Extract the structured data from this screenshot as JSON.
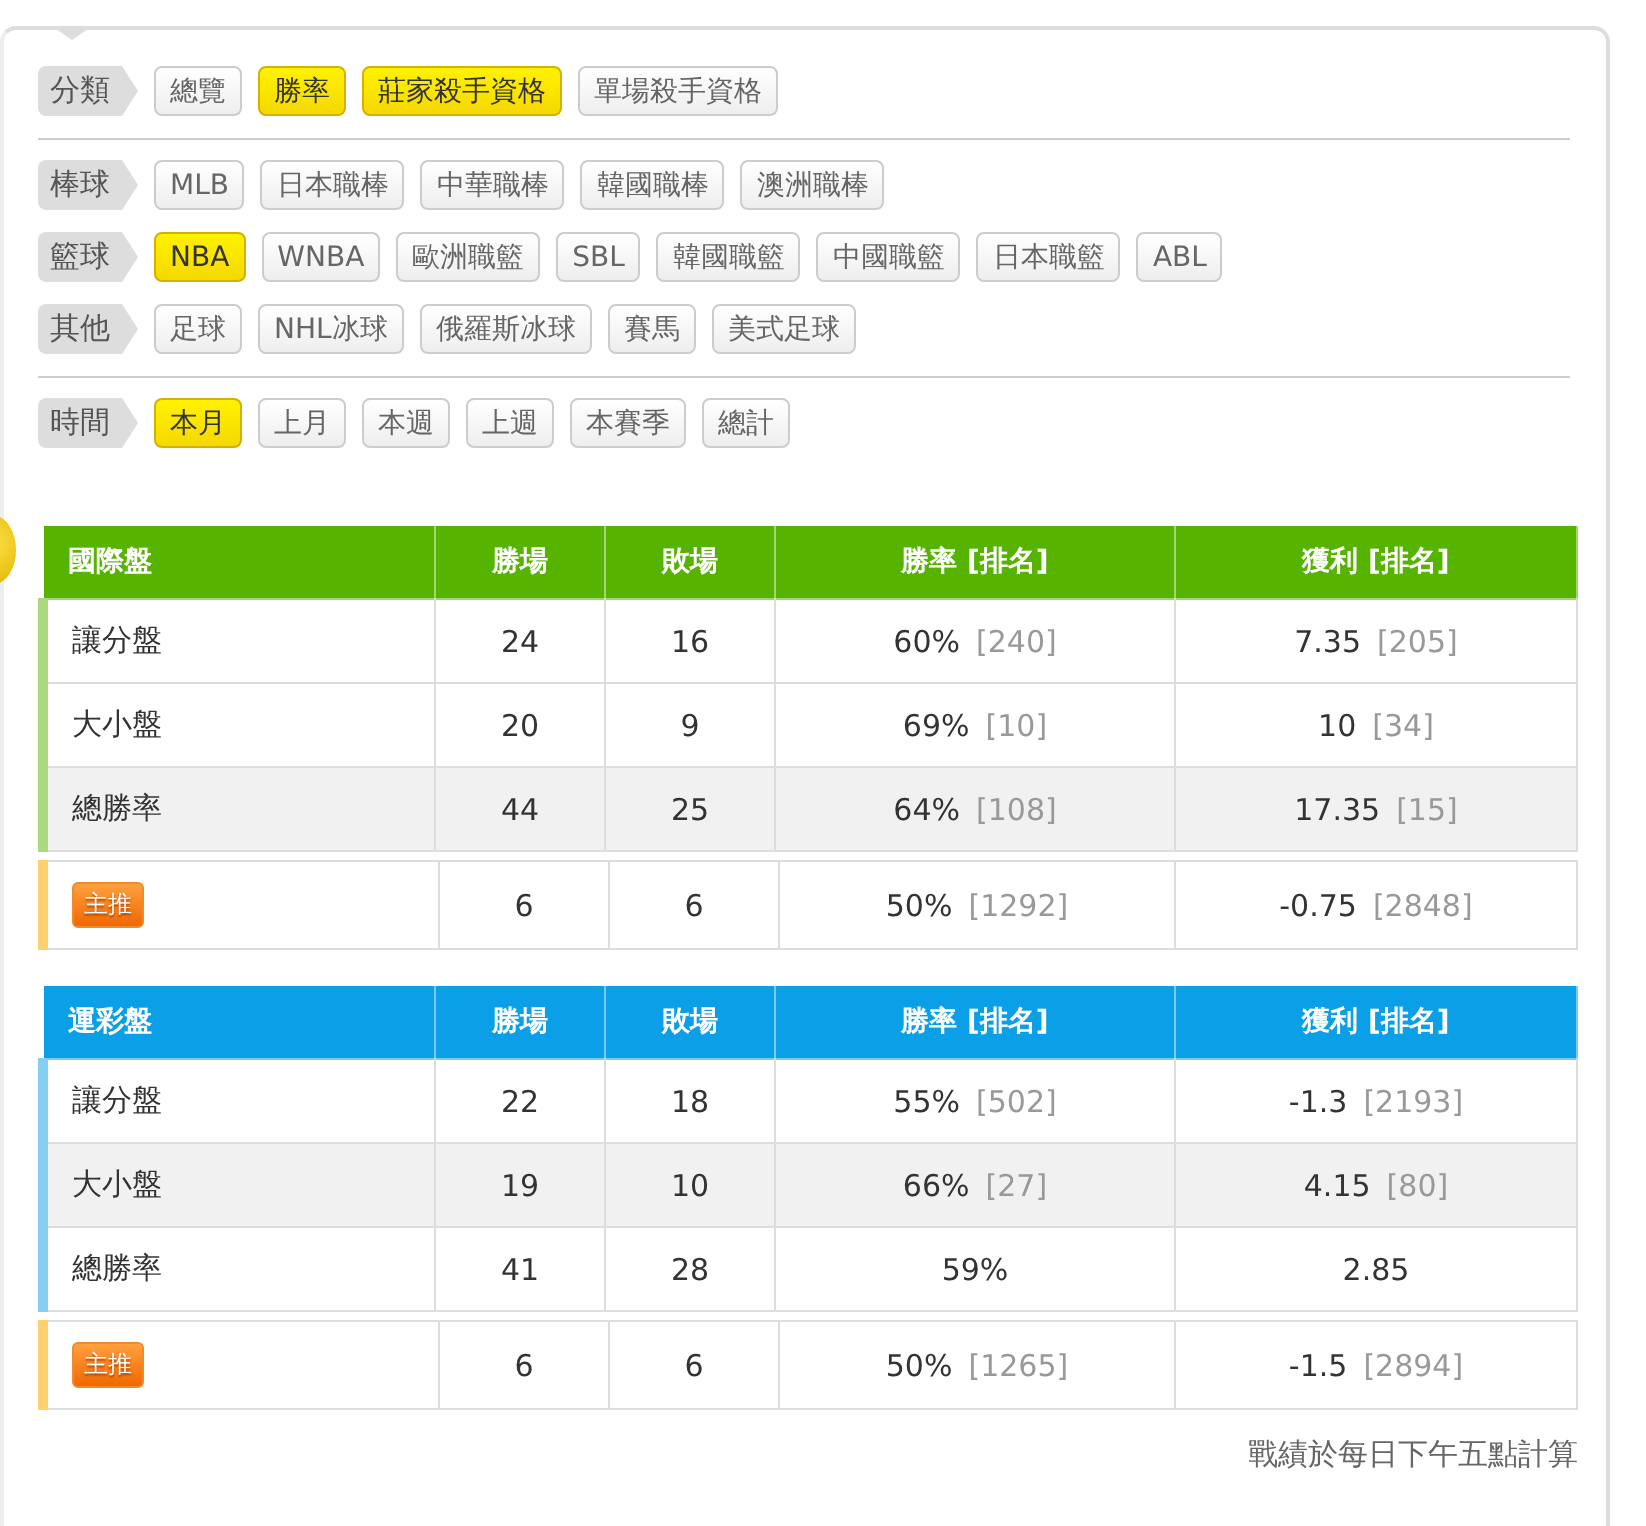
{
  "filter_sections": [
    [
      {
        "label": "分類",
        "options": [
          {
            "text": "總覽",
            "selected": false
          },
          {
            "text": "勝率",
            "selected": true
          },
          {
            "text": "莊家殺手資格",
            "selected": true
          },
          {
            "text": "單場殺手資格",
            "selected": false
          }
        ]
      }
    ],
    [
      {
        "label": "棒球",
        "options": [
          {
            "text": "MLB",
            "selected": false
          },
          {
            "text": "日本職棒",
            "selected": false
          },
          {
            "text": "中華職棒",
            "selected": false
          },
          {
            "text": "韓國職棒",
            "selected": false
          },
          {
            "text": "澳洲職棒",
            "selected": false
          }
        ]
      },
      {
        "label": "籃球",
        "options": [
          {
            "text": "NBA",
            "selected": true
          },
          {
            "text": "WNBA",
            "selected": false
          },
          {
            "text": "歐洲職籃",
            "selected": false
          },
          {
            "text": "SBL",
            "selected": false
          },
          {
            "text": "韓國職籃",
            "selected": false
          },
          {
            "text": "中國職籃",
            "selected": false
          },
          {
            "text": "日本職籃",
            "selected": false
          },
          {
            "text": "ABL",
            "selected": false
          }
        ]
      },
      {
        "label": "其他",
        "options": [
          {
            "text": "足球",
            "selected": false
          },
          {
            "text": "NHL冰球",
            "selected": false
          },
          {
            "text": "俄羅斯冰球",
            "selected": false
          },
          {
            "text": "賽馬",
            "selected": false
          },
          {
            "text": "美式足球",
            "selected": false
          }
        ]
      }
    ],
    [
      {
        "label": "時間",
        "options": [
          {
            "text": "本月",
            "selected": true
          },
          {
            "text": "上月",
            "selected": false
          },
          {
            "text": "本週",
            "selected": false
          },
          {
            "text": "上週",
            "selected": false
          },
          {
            "text": "本賽季",
            "selected": false
          },
          {
            "text": "總計",
            "selected": false
          }
        ]
      }
    ]
  ],
  "tables": [
    {
      "color": "#56b300",
      "columns": [
        "國際盤",
        "勝場",
        "敗場",
        "勝率 [排名]",
        "獲利 [排名]"
      ],
      "rows": [
        {
          "name": "讓分盤",
          "wins": "24",
          "losses": "16",
          "rate": "60%",
          "rate_rank": "[240]",
          "profit": "7.35",
          "profit_rank": "[205]",
          "shaded": false
        },
        {
          "name": "大小盤",
          "wins": "20",
          "losses": "9",
          "rate": "69%",
          "rate_rank": "[10]",
          "profit": "10",
          "profit_rank": "[34]",
          "shaded": false
        },
        {
          "name": "總勝率",
          "wins": "44",
          "losses": "25",
          "rate": "64%",
          "rate_rank": "[108]",
          "profit": "17.35",
          "profit_rank": "[15]",
          "shaded": true
        }
      ],
      "featured": {
        "badge": "主推",
        "wins": "6",
        "losses": "6",
        "rate": "50%",
        "rate_rank": "[1292]",
        "profit": "-0.75",
        "profit_rank": "[2848]"
      }
    },
    {
      "color": "#0a9fe6",
      "columns": [
        "運彩盤",
        "勝場",
        "敗場",
        "勝率 [排名]",
        "獲利 [排名]"
      ],
      "rows": [
        {
          "name": "讓分盤",
          "wins": "22",
          "losses": "18",
          "rate": "55%",
          "rate_rank": "[502]",
          "profit": "-1.3",
          "profit_rank": "[2193]",
          "shaded": false
        },
        {
          "name": "大小盤",
          "wins": "19",
          "losses": "10",
          "rate": "66%",
          "rate_rank": "[27]",
          "profit": "4.15",
          "profit_rank": "[80]",
          "shaded": true
        },
        {
          "name": "總勝率",
          "wins": "41",
          "losses": "28",
          "rate": "59%",
          "profit": "2.85",
          "shaded": false
        }
      ],
      "featured": {
        "badge": "主推",
        "wins": "6",
        "losses": "6",
        "rate": "50%",
        "rate_rank": "[1265]",
        "profit": "-1.5",
        "profit_rank": "[2894]"
      }
    }
  ],
  "footnote": "戰績於每日下午五點計算"
}
